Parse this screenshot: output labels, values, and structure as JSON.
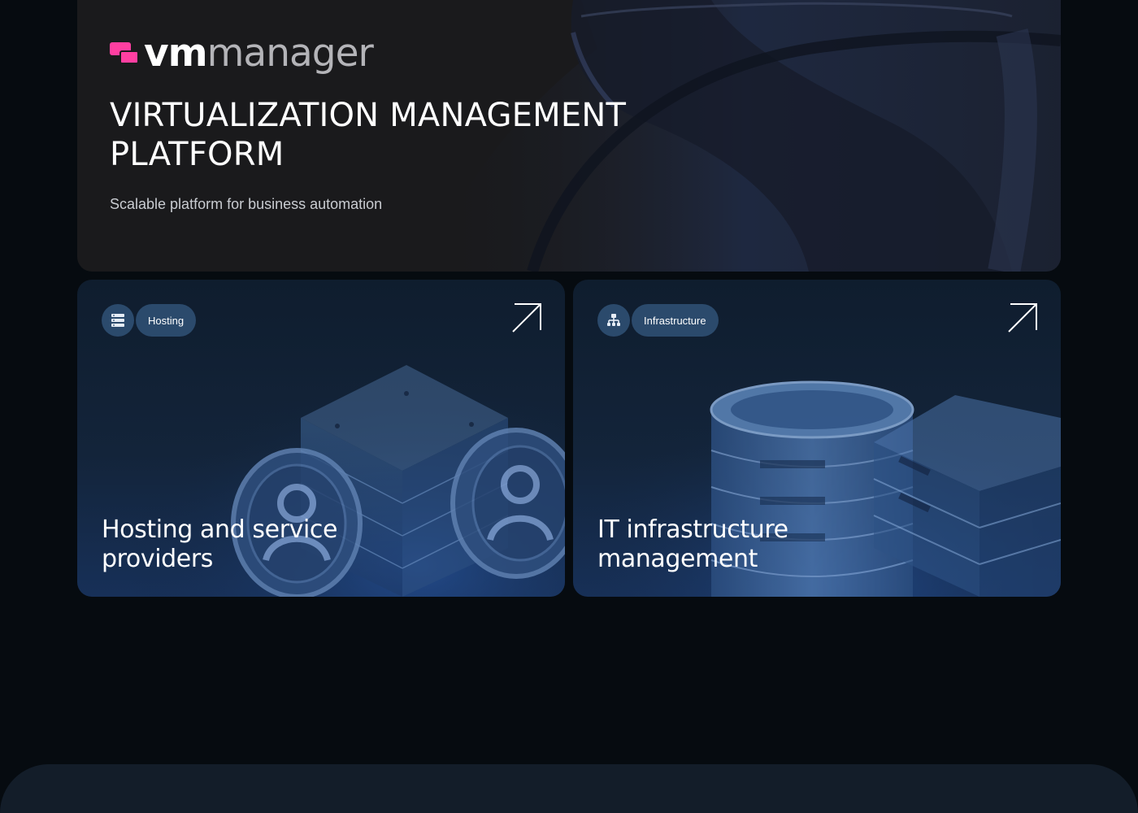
{
  "hero": {
    "logo": {
      "primary": "vm",
      "secondary": "manager"
    },
    "title": "VIRTUALIZATION MANAGEMENT PLATFORM",
    "subtitle": "Scalable platform for business automation"
  },
  "cards": [
    {
      "tag": "Hosting",
      "tag_icon": "server-rack-icon",
      "title": "Hosting and service providers",
      "arrow_icon": "arrow-up-right-icon"
    },
    {
      "tag": "Infrastructure",
      "tag_icon": "network-hierarchy-icon",
      "title": "IT infrastructure management",
      "arrow_icon": "arrow-up-right-icon"
    }
  ],
  "colors": {
    "page_bg": "#060b10",
    "hero_bg": "#1a1a1c",
    "brand_pink": "#ff3fa1",
    "chip_bg": "#2b4a6c",
    "card_bg": "#13243a",
    "bottom_panel": "#131d29"
  }
}
